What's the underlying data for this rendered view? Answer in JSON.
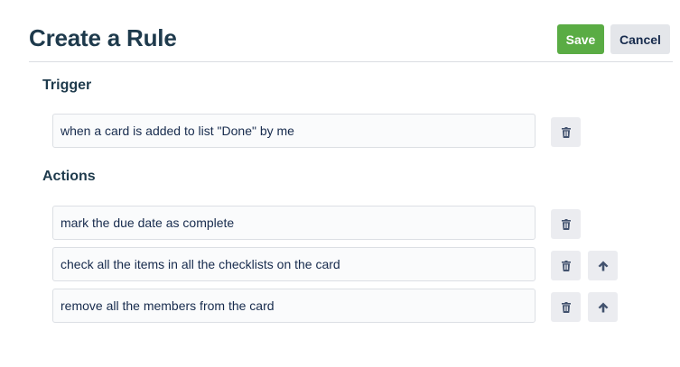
{
  "header": {
    "title": "Create a Rule",
    "save_label": "Save",
    "cancel_label": "Cancel"
  },
  "trigger": {
    "label": "Trigger",
    "text": "when a card is added to list \"Done\" by me"
  },
  "actions": {
    "label": "Actions",
    "items": [
      {
        "text": "mark the due date as complete"
      },
      {
        "text": "check all the items in all the checklists on the card"
      },
      {
        "text": "remove all the members from the card"
      }
    ]
  },
  "colors": {
    "save_button": "#5aac44",
    "cancel_button": "#e4e6ea",
    "icon_button": "#ebecf0",
    "title_text": "#1e3a4c"
  },
  "icons": {
    "delete": "trash-icon",
    "move_up": "arrow-up-icon"
  }
}
